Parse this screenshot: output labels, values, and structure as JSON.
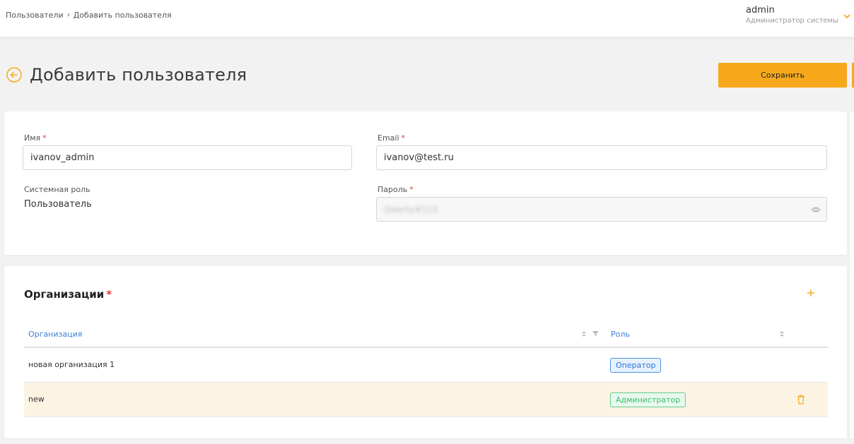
{
  "breadcrumb": {
    "parent": "Пользователи",
    "separator": "›",
    "current": "Добавить пользователя"
  },
  "user": {
    "name": "admin",
    "role": "Администратор системы"
  },
  "page": {
    "title": "Добавить пользователя",
    "save_label": "Сохранить"
  },
  "form": {
    "name": {
      "label": "Имя",
      "required": "*",
      "value": "ivanov_admin"
    },
    "email": {
      "label": "Email",
      "required": "*",
      "value": "ivanov@test.ru"
    },
    "system_role": {
      "label": "Системная роль",
      "value": "Пользователь"
    },
    "password": {
      "label": "Пароль",
      "required": "*",
      "value": "Qwerty#123"
    }
  },
  "organizations": {
    "title": "Организации",
    "required": "*",
    "columns": {
      "organization": "Организация",
      "role": "Роль"
    },
    "rows": [
      {
        "organization": "новая организация 1",
        "role": "Оператор",
        "role_color": "blue",
        "highlighted": false
      },
      {
        "organization": "new",
        "role": "Администратор",
        "role_color": "green",
        "highlighted": true
      }
    ]
  },
  "colors": {
    "accent": "#f7a81b",
    "link": "#3f7fd6",
    "required": "#e53935"
  },
  "icons": [
    "back-arrow-icon",
    "chevron-down-icon",
    "eye-icon",
    "plus-icon",
    "sort-icon",
    "filter-icon",
    "trash-icon"
  ]
}
